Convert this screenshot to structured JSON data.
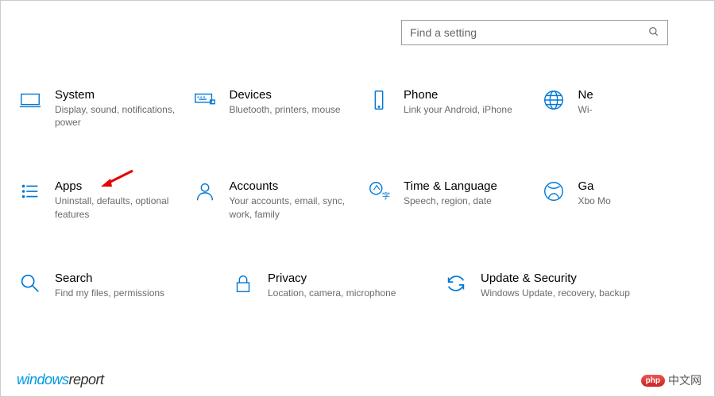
{
  "search": {
    "placeholder": "Find a setting"
  },
  "categories": [
    [
      {
        "id": "system",
        "title": "System",
        "desc": "Display, sound, notifications, power",
        "icon": "monitor-icon"
      },
      {
        "id": "devices",
        "title": "Devices",
        "desc": "Bluetooth, printers, mouse",
        "icon": "keyboard-icon"
      },
      {
        "id": "phone",
        "title": "Phone",
        "desc": "Link your Android, iPhone",
        "icon": "phone-icon"
      },
      {
        "id": "network",
        "title": "Ne",
        "desc": "Wi-",
        "icon": "globe-icon"
      }
    ],
    [
      {
        "id": "apps",
        "title": "Apps",
        "desc": "Uninstall, defaults, optional features",
        "icon": "list-icon"
      },
      {
        "id": "accounts",
        "title": "Accounts",
        "desc": "Your accounts, email, sync, work, family",
        "icon": "person-icon"
      },
      {
        "id": "time",
        "title": "Time & Language",
        "desc": "Speech, region, date",
        "icon": "language-icon"
      },
      {
        "id": "gaming",
        "title": "Ga",
        "desc": "Xbo Mo",
        "icon": "xbox-icon"
      }
    ],
    [
      {
        "id": "search",
        "title": "Search",
        "desc": "Find my files, permissions",
        "icon": "search-icon"
      },
      {
        "id": "privacy",
        "title": "Privacy",
        "desc": "Location, camera, microphone",
        "icon": "lock-icon"
      },
      {
        "id": "update",
        "title": "Update & Security",
        "desc": "Windows Update, recovery, backup",
        "icon": "sync-icon"
      }
    ]
  ],
  "watermarks": {
    "left_a": "windows",
    "left_b": "report",
    "right_badge": "php",
    "right_text": "中文网"
  },
  "colors": {
    "accent": "#0078d7",
    "arrow": "#e60000"
  }
}
